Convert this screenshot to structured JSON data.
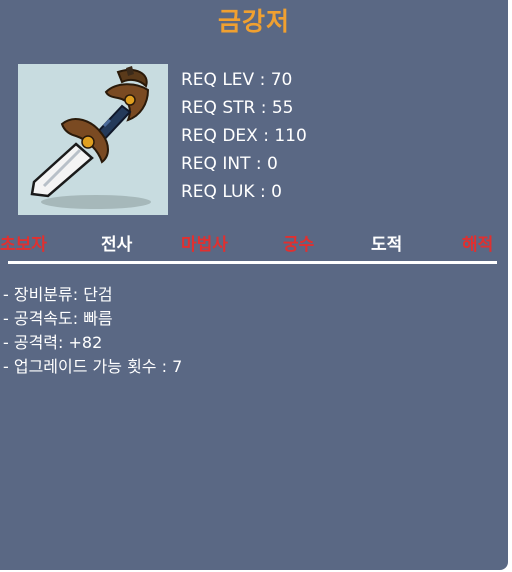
{
  "item": {
    "name": "금강저",
    "icon": "dagger-weapon-icon"
  },
  "requirements": [
    "REQ LEV : 70",
    "REQ STR : 55",
    "REQ DEX : 110",
    "REQ INT : 0",
    "REQ LUK : 0"
  ],
  "jobs": [
    {
      "label": "초보자",
      "color": "#e03030"
    },
    {
      "label": "전사",
      "color": "#ffffff"
    },
    {
      "label": "마법사",
      "color": "#e03030"
    },
    {
      "label": "궁수",
      "color": "#e03030"
    },
    {
      "label": "도적",
      "color": "#ffffff"
    },
    {
      "label": "해적",
      "color": "#e03030"
    }
  ],
  "stats": [
    "- 장비분류: 단검",
    "- 공격속도: 빠름",
    "- 공격력: +82",
    "- 업그레이드 가능 횟수 : 7"
  ],
  "colors": {
    "panel": "#5a6884",
    "title": "#f0a030",
    "text": "#ffffff",
    "restricted": "#e03030"
  }
}
